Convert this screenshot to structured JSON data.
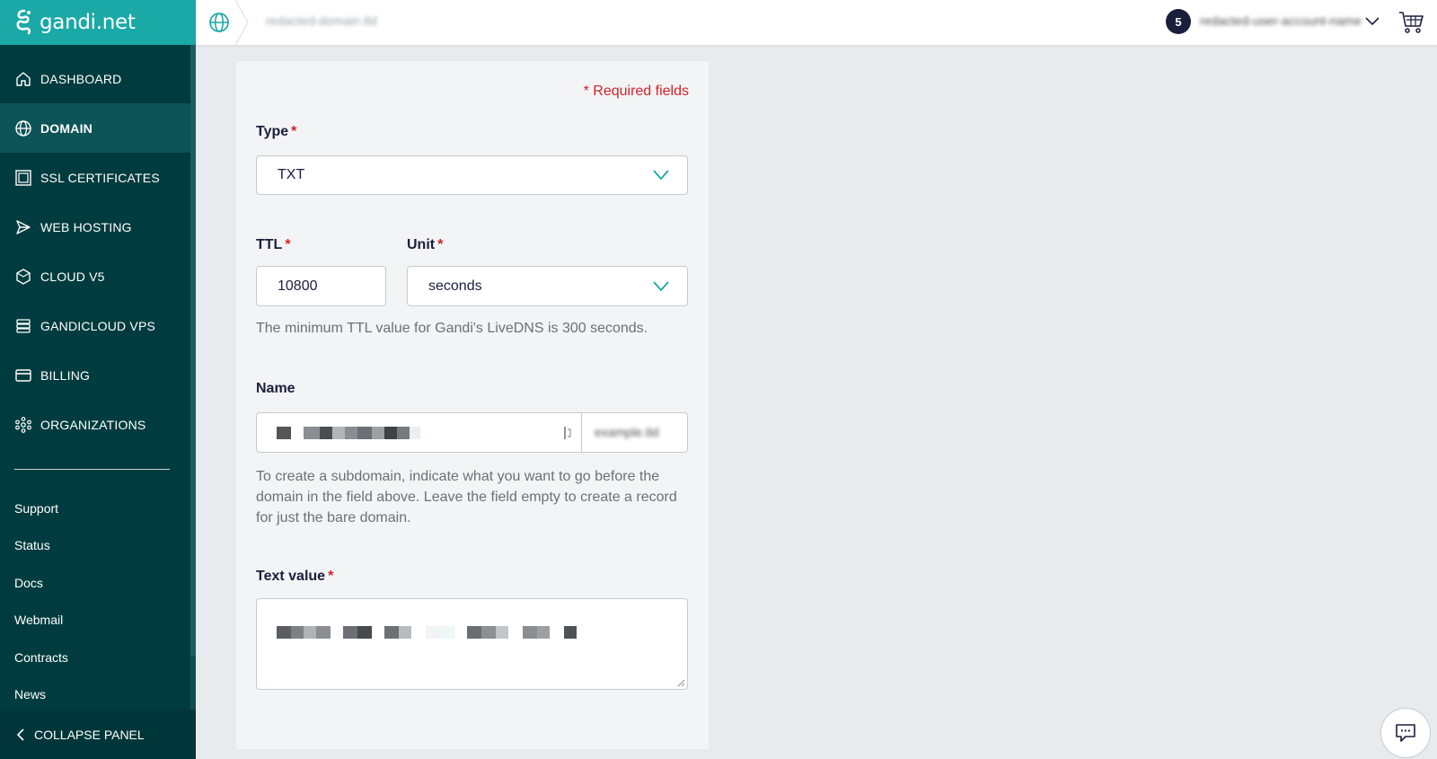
{
  "brand": {
    "name": "gandi.net"
  },
  "sidebar": {
    "nav": [
      {
        "label": "DASHBOARD",
        "icon": "home-icon",
        "active": false
      },
      {
        "label": "DOMAIN",
        "icon": "globe-icon",
        "active": true
      },
      {
        "label": "SSL CERTIFICATES",
        "icon": "certificate-icon",
        "active": false
      },
      {
        "label": "WEB HOSTING",
        "icon": "send-icon",
        "active": false
      },
      {
        "label": "CLOUD V5",
        "icon": "hexagon-icon",
        "active": false
      },
      {
        "label": "GANDICLOUD VPS",
        "icon": "server-stack-icon",
        "active": false
      },
      {
        "label": "BILLING",
        "icon": "credit-card-icon",
        "active": false
      },
      {
        "label": "ORGANIZATIONS",
        "icon": "organization-icon",
        "active": false
      }
    ],
    "links": [
      "Support",
      "Status",
      "Docs",
      "Webmail",
      "Contracts",
      "News"
    ],
    "collapse_label": "COLLAPSE PANEL"
  },
  "topbar": {
    "breadcrumb": "redacted-domain.tld",
    "notifications_count": "5",
    "user_name": "redacted-user-account-name"
  },
  "form": {
    "required_note": "* Required fields",
    "type": {
      "label": "Type",
      "value": "TXT"
    },
    "ttl": {
      "label": "TTL",
      "value": "10800"
    },
    "unit": {
      "label": "Unit",
      "value": "seconds"
    },
    "ttl_help": "The minimum TTL value for Gandi's LiveDNS is 300 seconds.",
    "name": {
      "label": "Name",
      "suffix": "example.tld"
    },
    "name_help": "To create a subdomain, indicate what you want to go before the domain in the field above. Leave the field empty to create a record for just the bare domain.",
    "text_value": {
      "label": "Text value"
    }
  },
  "colors": {
    "accent": "#1aa9a6",
    "sidebar_bg": "#003c3f",
    "required": "#d3222a",
    "text": "#1a1f3c"
  }
}
